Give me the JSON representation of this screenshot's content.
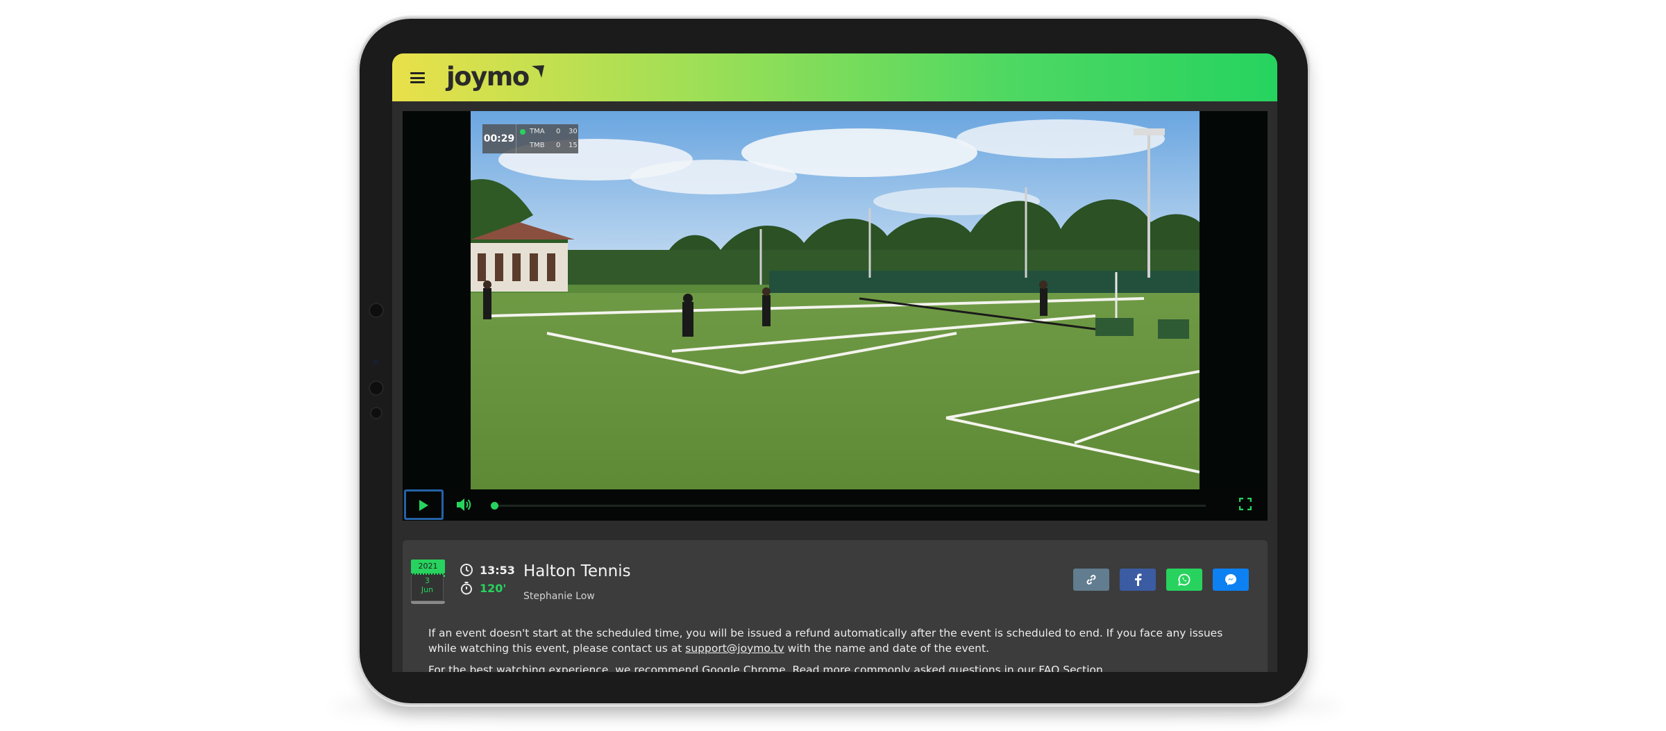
{
  "header": {
    "brand": "joymo",
    "menu_icon": "hamburger-icon",
    "gradient": [
      "#e9e04a",
      "#26d35f"
    ]
  },
  "video": {
    "scoreboard": {
      "time": "00:29",
      "teams": [
        {
          "name": "TMA",
          "serving": true,
          "score1": "0",
          "score2": "30"
        },
        {
          "name": "TMB",
          "serving": false,
          "score1": "0",
          "score2": "15"
        }
      ]
    },
    "controls": {
      "play_icon": "play-icon",
      "volume_icon": "volume-icon",
      "fullscreen_icon": "fullscreen-icon",
      "progress": 0,
      "accent": "#27d35e"
    }
  },
  "event": {
    "date": {
      "year": "2021",
      "day": "3",
      "month": "Jun"
    },
    "start_time": "13:53",
    "duration": "120'",
    "title": "Halton Tennis",
    "organizer": "Stephanie Low"
  },
  "share": {
    "icons": [
      "link-icon",
      "facebook-icon",
      "whatsapp-icon",
      "messenger-icon"
    ],
    "colors": [
      "#617d8f",
      "#3b5ba3",
      "#27d35e",
      "#0d80f2"
    ]
  },
  "notice": {
    "line1_before": "If an event doesn't start at the scheduled time, you will be issued a refund automatically after the event is scheduled to end. If you face any issues while watching this event, please contact us at ",
    "email": "support@joymo.tv",
    "line1_after": " with the name and date of the event.",
    "line2": "For the best watching experience, we recommend Google Chrome. Read more commonly asked questions in our FAQ Section."
  }
}
